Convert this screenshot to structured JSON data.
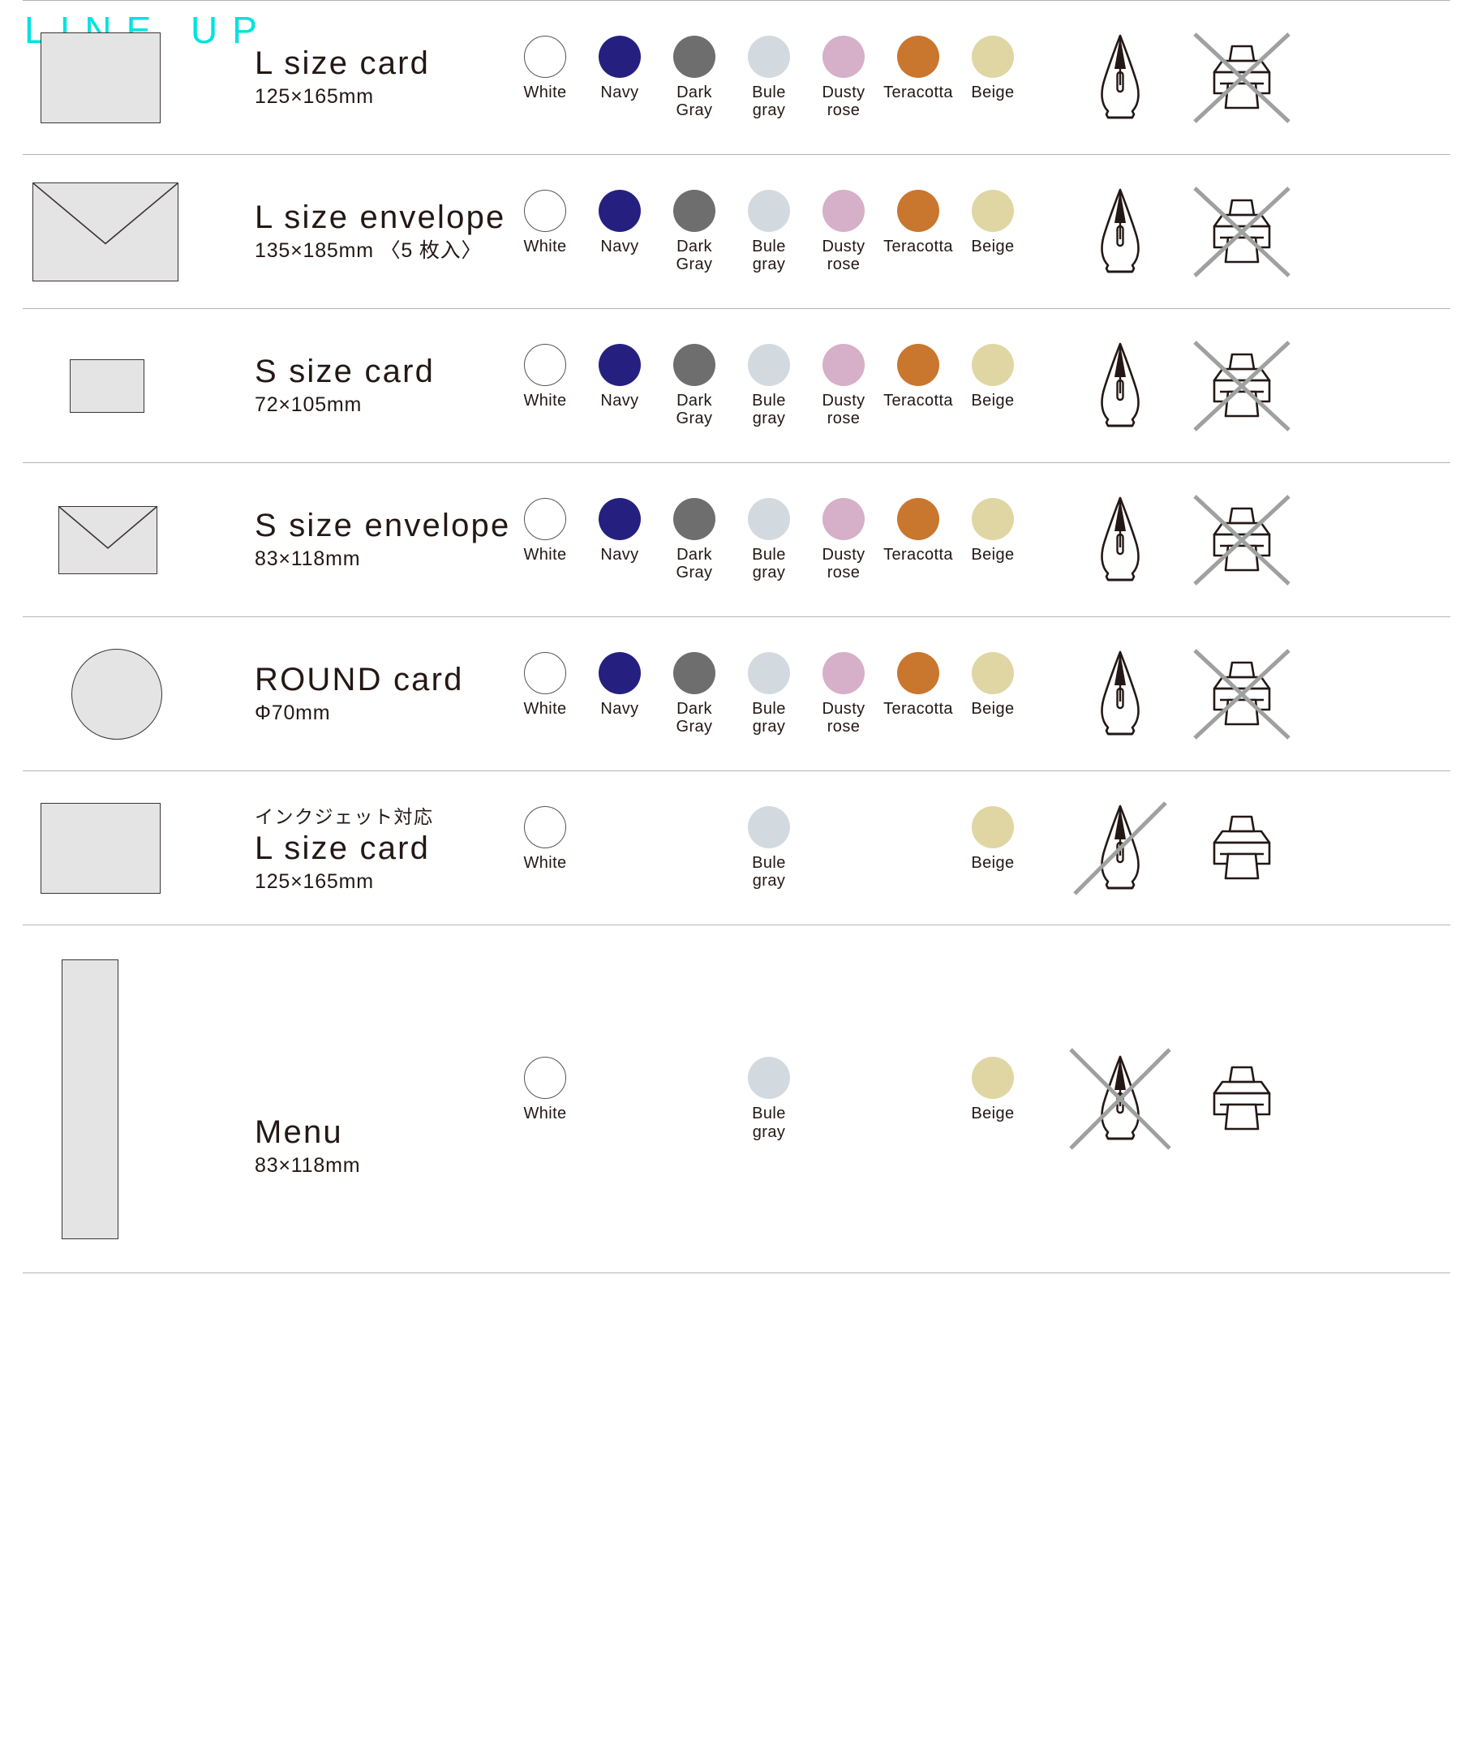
{
  "header": {
    "title": "LINE UP"
  },
  "palette": {
    "white": "#ffffff",
    "navy": "#252080",
    "dark_gray": "#6e6e6e",
    "bule_gray": "#d3dadf",
    "dusty_rose": "#d6afc9",
    "teracotta": "#c9762f",
    "beige": "#dfd6a4",
    "title_accent": "#00e2e0",
    "thumb_fill": "#e4e4e4",
    "thumb_stroke": "#3c3335",
    "rule": "#b5b5b6",
    "disable_slash": "#9fa0a0"
  },
  "colors": {
    "white": {
      "label": "White",
      "hex": "#ffffff",
      "outline": true
    },
    "navy": {
      "label": "Navy",
      "hex": "#252080",
      "outline": false
    },
    "dark_gray": {
      "label": "Dark\nGray",
      "hex": "#6e6e6e",
      "outline": false
    },
    "bule_gray": {
      "label": "Bule\ngray",
      "hex": "#d3dadf",
      "outline": false
    },
    "dusty_rose": {
      "label": "Dusty\nrose",
      "hex": "#d6afc9",
      "outline": false
    },
    "teracotta": {
      "label": "Teracotta",
      "hex": "#c9762f",
      "outline": false
    },
    "beige": {
      "label": "Beige",
      "hex": "#dfd6a4",
      "outline": false
    }
  },
  "rows": [
    {
      "id": "l-size-card",
      "shape": "rect",
      "pre_label": "",
      "name": "L size card",
      "size": "125×165mm",
      "colors": [
        "white",
        "navy",
        "dark_gray",
        "bule_gray",
        "dusty_rose",
        "teracotta",
        "beige"
      ],
      "pen_icon": "pen-nib-icon",
      "pen_enabled": true,
      "printer_icon": "printer-icon",
      "printer_enabled": false
    },
    {
      "id": "l-size-envelope",
      "shape": "envelope",
      "pre_label": "",
      "name": "L size envelope",
      "size": "135×185mm 〈5 枚入〉",
      "colors": [
        "white",
        "navy",
        "dark_gray",
        "bule_gray",
        "dusty_rose",
        "teracotta",
        "beige"
      ],
      "pen_icon": "pen-nib-icon",
      "pen_enabled": true,
      "printer_icon": "printer-icon",
      "printer_enabled": false
    },
    {
      "id": "s-size-card",
      "shape": "rect",
      "pre_label": "",
      "name": "S size card",
      "size": "72×105mm",
      "colors": [
        "white",
        "navy",
        "dark_gray",
        "bule_gray",
        "dusty_rose",
        "teracotta",
        "beige"
      ],
      "pen_icon": "pen-nib-icon",
      "pen_enabled": true,
      "printer_icon": "printer-icon",
      "printer_enabled": false
    },
    {
      "id": "s-size-envelope",
      "shape": "envelope",
      "pre_label": "",
      "name": "S size envelope",
      "size": "83×118mm",
      "colors": [
        "white",
        "navy",
        "dark_gray",
        "bule_gray",
        "dusty_rose",
        "teracotta",
        "beige"
      ],
      "pen_icon": "pen-nib-icon",
      "pen_enabled": true,
      "printer_icon": "printer-icon",
      "printer_enabled": false
    },
    {
      "id": "round-card",
      "shape": "circle",
      "pre_label": "",
      "name": "ROUND card",
      "size": "Φ70mm",
      "colors": [
        "white",
        "navy",
        "dark_gray",
        "bule_gray",
        "dusty_rose",
        "teracotta",
        "beige"
      ],
      "pen_icon": "pen-nib-icon",
      "pen_enabled": true,
      "printer_icon": "printer-icon",
      "printer_enabled": false
    },
    {
      "id": "inkjet-l-size-card",
      "shape": "rect",
      "pre_label": "インクジェット対応",
      "name": "L size card",
      "size": "125×165mm",
      "colors": [
        "white",
        null,
        null,
        "bule_gray",
        null,
        null,
        "beige"
      ],
      "pen_icon": "pen-nib-icon",
      "pen_enabled": false,
      "pen_disable_style": "slash",
      "printer_icon": "printer-icon",
      "printer_enabled": true
    },
    {
      "id": "menu",
      "shape": "tall-rect",
      "pre_label": "",
      "name": "Menu",
      "size": "83×118mm",
      "colors": [
        "white",
        null,
        null,
        "bule_gray",
        null,
        null,
        "beige"
      ],
      "pen_icon": "pen-nib-icon",
      "pen_enabled": false,
      "pen_disable_style": "cross",
      "printer_icon": "printer-icon",
      "printer_enabled": true
    }
  ]
}
